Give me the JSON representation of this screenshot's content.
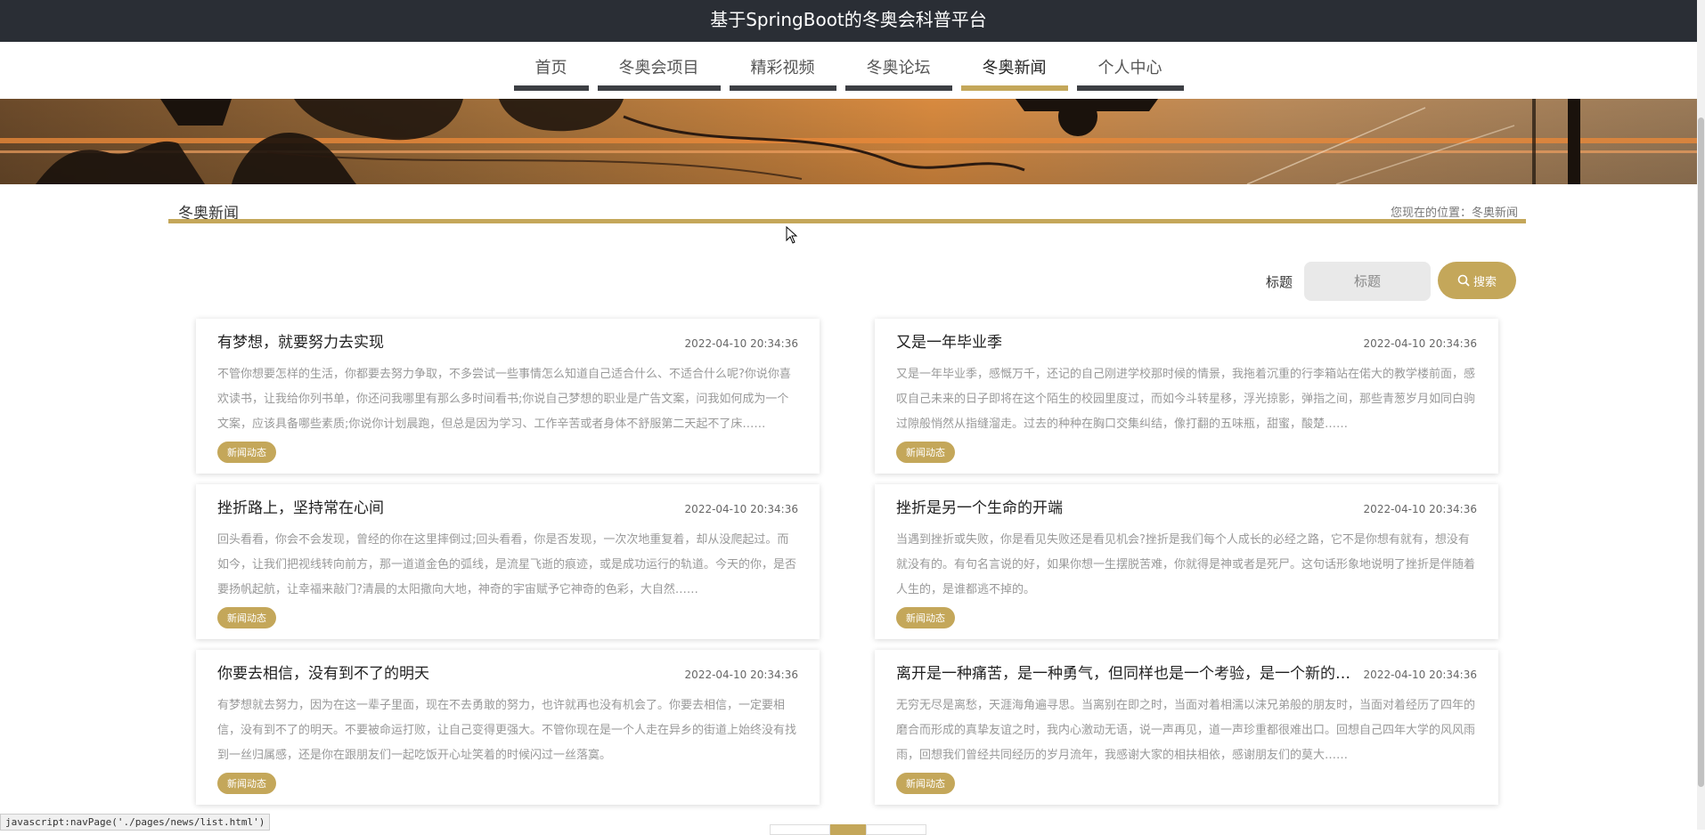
{
  "header": {
    "title": "基于SpringBoot的冬奥会科普平台"
  },
  "nav": {
    "items": [
      {
        "label": "首页"
      },
      {
        "label": "冬奥会项目"
      },
      {
        "label": "精彩视频"
      },
      {
        "label": "冬奥论坛"
      },
      {
        "label": "冬奥新闻",
        "active": true
      },
      {
        "label": "个人中心"
      }
    ]
  },
  "page": {
    "section_title": "冬奥新闻",
    "breadcrumb": "您现在的位置：冬奥新闻"
  },
  "search": {
    "label": "标题",
    "placeholder": "标题",
    "button_label": "搜索"
  },
  "news": [
    {
      "title": "有梦想，就要努力去实现",
      "date": "2022-04-10 20:34:36",
      "summary": "不管你想要怎样的生活，你都要去努力争取，不多尝试一些事情怎么知道自己适合什么、不适合什么呢?你说你喜欢读书，让我给你列书单，你还问我哪里有那么多时间看书;你说自己梦想的职业是广告文案，问我如何成为一个文案，应该具备哪些素质;你说你计划晨跑，但总是因为学习、工作辛苦或者身体不舒服第二天起不了床……",
      "tag": "新闻动态"
    },
    {
      "title": "又是一年毕业季",
      "date": "2022-04-10 20:34:36",
      "summary": "又是一年毕业季，感慨万千，还记的自己刚进学校那时候的情景，我拖着沉重的行李箱站在偌大的教学楼前面，感叹自己未来的日子即将在这个陌生的校园里度过，而如今斗转星移，浮光掠影，弹指之间，那些青葱岁月如同白驹过隙般悄然从指缝溜走。过去的种种在胸口交集纠结，像打翻的五味瓶，甜蜜，酸楚……",
      "tag": "新闻动态"
    },
    {
      "title": "挫折路上，坚持常在心间",
      "date": "2022-04-10 20:34:36",
      "summary": "回头看看，你会不会发现，曾经的你在这里摔倒过;回头看看，你是否发现，一次次地重复着，却从没爬起过。而如今，让我们把视线转向前方，那一道道金色的弧线，是流星飞逝的痕迹，或是成功运行的轨道。今天的你，是否要扬帆起航，让幸福来敲门?清晨的太阳撒向大地，神奇的宇宙赋予它神奇的色彩，大自然……",
      "tag": "新闻动态"
    },
    {
      "title": "挫折是另一个生命的开端",
      "date": "2022-04-10 20:34:36",
      "summary": "当遇到挫折或失败，你是看见失败还是看见机会?挫折是我们每个人成长的必经之路，它不是你想有就有，想没有就没有的。有句名言说的好，如果你想一生摆脱苦难，你就得是神或者是死尸。这句话形象地说明了挫折是伴随着人生的，是谁都逃不掉的。",
      "tag": "新闻动态"
    },
    {
      "title": "你要去相信，没有到不了的明天",
      "date": "2022-04-10 20:34:36",
      "summary": "有梦想就去努力，因为在这一辈子里面，现在不去勇敢的努力，也许就再也没有机会了。你要去相信，一定要相信，没有到不了的明天。不要被命运打败，让自己变得更强大。不管你现在是一个人走在异乡的街道上始终没有找到一丝归属感，还是你在跟朋友们一起吃饭开心址笑着的时候闪过一丝落寞。",
      "tag": "新闻动态"
    },
    {
      "title": "离开是一种痛苦，是一种勇气，但同样也是一个考验，是一个新的开始",
      "date": "2022-04-10 20:34:36",
      "summary": "无穷无尽是离愁，天涯海角遍寻思。当离别在即之时，当面对着相濡以沫兄弟般的朋友时，当面对着经历了四年的磨合而形成的真挚友谊之时，我内心激动无语，说一声再见，道一声珍重都很难出口。回想自己四年大学的风风雨雨，回想我们曾经共同经历的岁月流年，我感谢大家的相扶相依，感谢朋友们的莫大……",
      "tag": "新闻动态"
    }
  ],
  "status_bar": {
    "url": "javascript:navPage('./pages/news/list.html')"
  },
  "colors": {
    "accent": "#c4a75a",
    "topbar": "#2a2e35"
  }
}
